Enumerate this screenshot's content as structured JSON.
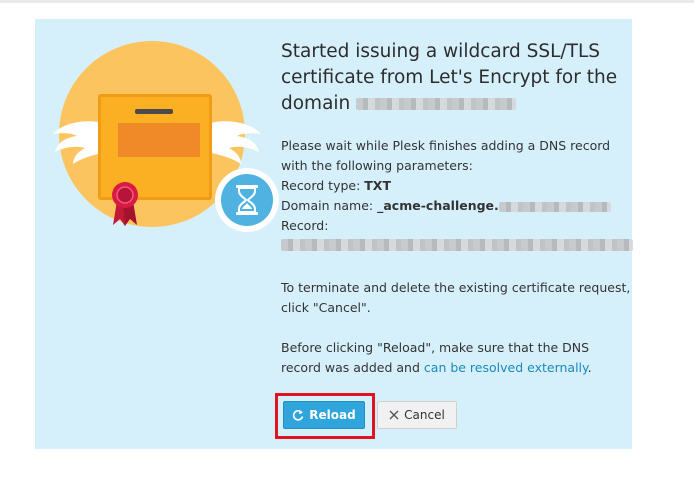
{
  "dialog": {
    "title_prefix": "Started issuing a wildcard SSL/TLS certificate from Let's Encrypt for the domain",
    "wait_text": "Please wait while Plesk finishes adding a DNS record with the following parameters:",
    "record_type_label": "Record type:",
    "record_type_value": "TXT",
    "domain_name_label": "Domain name:",
    "domain_name_value": "_acme-challenge.",
    "record_label": "Record:",
    "terminate_text": "To terminate and delete the existing certificate request, click \"Cancel\".",
    "before_text": "Before clicking \"Reload\", make sure that the DNS record was added and",
    "resolved_link": "can be resolved externally",
    "period": "."
  },
  "buttons": {
    "reload_label": "Reload",
    "cancel_label": "Cancel"
  },
  "icons": {
    "reload": "refresh-icon",
    "cancel": "close-icon",
    "illustration": "certificate-hourglass-illustration"
  },
  "colors": {
    "panel_bg": "#d6f0fb",
    "accent_blue": "#2fa5dc",
    "link": "#1a8ab9",
    "highlight": "#e0141e"
  }
}
